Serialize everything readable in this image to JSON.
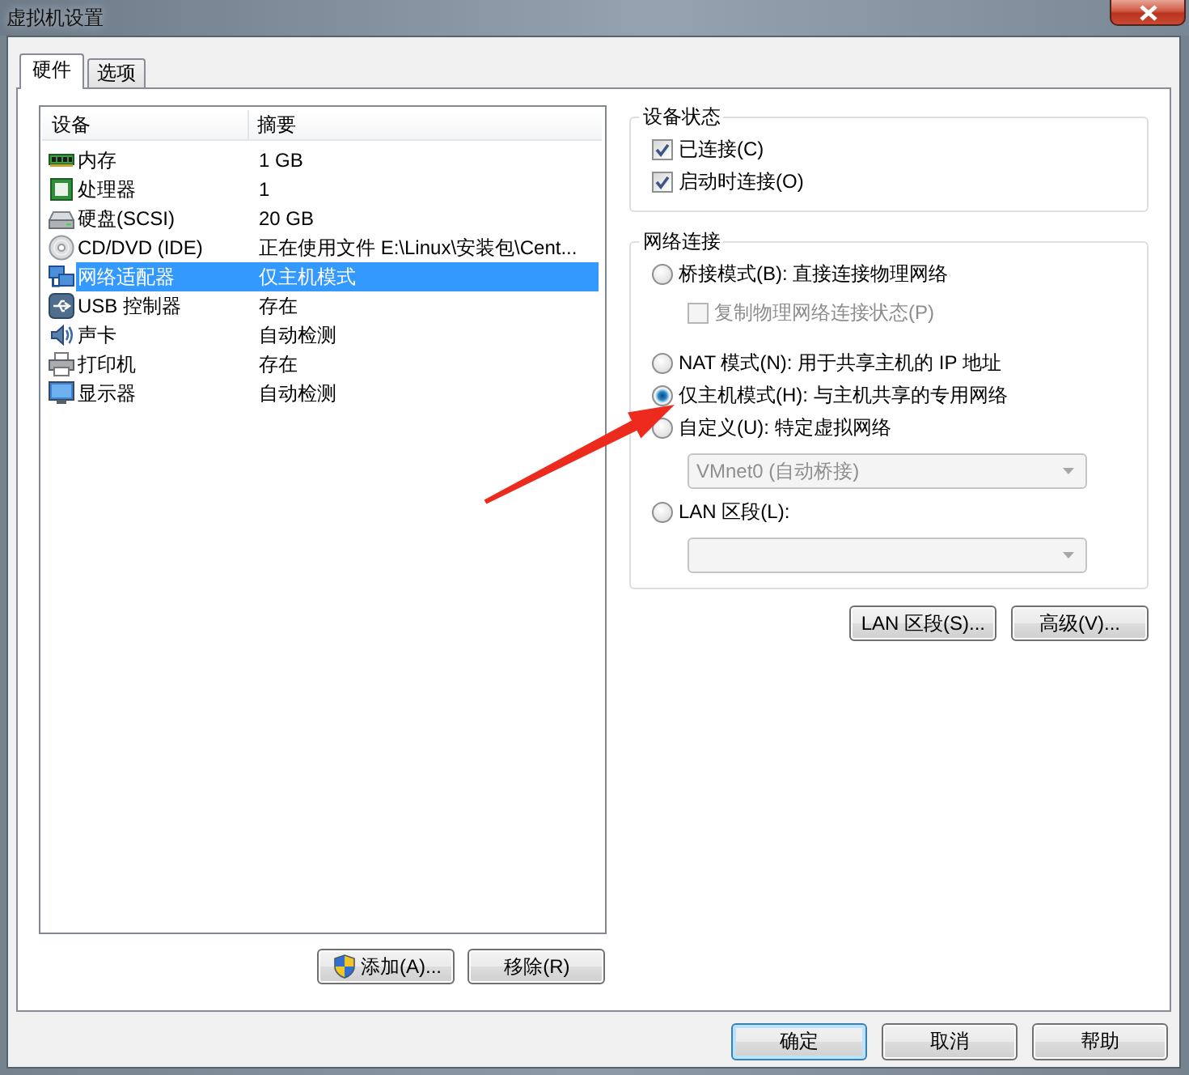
{
  "window": {
    "title": "虚拟机设置"
  },
  "tabs": [
    {
      "label": "硬件",
      "selected": true
    },
    {
      "label": "选项",
      "selected": false
    }
  ],
  "device_table": {
    "columns": [
      "设备",
      "摘要"
    ],
    "rows": [
      {
        "kind": "memory",
        "device": "内存",
        "summary": "1 GB",
        "selected": false
      },
      {
        "kind": "processor",
        "device": "处理器",
        "summary": "1",
        "selected": false
      },
      {
        "kind": "hard_disk",
        "device": "硬盘(SCSI)",
        "summary": "20 GB",
        "selected": false
      },
      {
        "kind": "cd_dvd",
        "device": "CD/DVD (IDE)",
        "summary": "正在使用文件 E:\\Linux\\安装包\\Cent...",
        "selected": false
      },
      {
        "kind": "network",
        "device": "网络适配器",
        "summary": "仅主机模式",
        "selected": true
      },
      {
        "kind": "usb",
        "device": "USB 控制器",
        "summary": "存在",
        "selected": false
      },
      {
        "kind": "sound",
        "device": "声卡",
        "summary": "自动检测",
        "selected": false
      },
      {
        "kind": "printer",
        "device": "打印机",
        "summary": "存在",
        "selected": false
      },
      {
        "kind": "display",
        "device": "显示器",
        "summary": "自动检测",
        "selected": false
      }
    ]
  },
  "list_buttons": [
    {
      "label": "添加(A)...",
      "elevated": true
    },
    {
      "label": "移除(R)",
      "elevated": false
    }
  ],
  "device_status": {
    "title": "设备状态",
    "options": [
      {
        "label": "已连接(C)",
        "checked": true
      },
      {
        "label": "启动时连接(O)",
        "checked": true
      }
    ]
  },
  "network_connection": {
    "title": "网络连接",
    "options": [
      {
        "label": "桥接模式(B): 直接连接物理网络",
        "selected": false,
        "children": [
          {
            "kind": "checkbox",
            "label": "复制物理网络连接状态(P)",
            "checked": false,
            "disabled": true
          }
        ]
      },
      {
        "label": "NAT 模式(N): 用于共享主机的 IP 地址",
        "selected": false
      },
      {
        "label": "仅主机模式(H): 与主机共享的专用网络",
        "selected": true
      },
      {
        "label": "自定义(U): 特定虚拟网络",
        "selected": false,
        "children": [
          {
            "kind": "dropdown",
            "value": "VMnet0 (自动桥接)",
            "disabled": true
          }
        ]
      },
      {
        "label": "LAN 区段(L):",
        "selected": false,
        "children": [
          {
            "kind": "dropdown",
            "disabled": true
          }
        ]
      }
    ]
  },
  "network_buttons": [
    "LAN 区段(S)...",
    "高级(V)..."
  ],
  "dialog_buttons": [
    {
      "label": "确定",
      "default": true
    },
    {
      "label": "取消",
      "default": false
    },
    {
      "label": "帮助",
      "default": false
    }
  ]
}
